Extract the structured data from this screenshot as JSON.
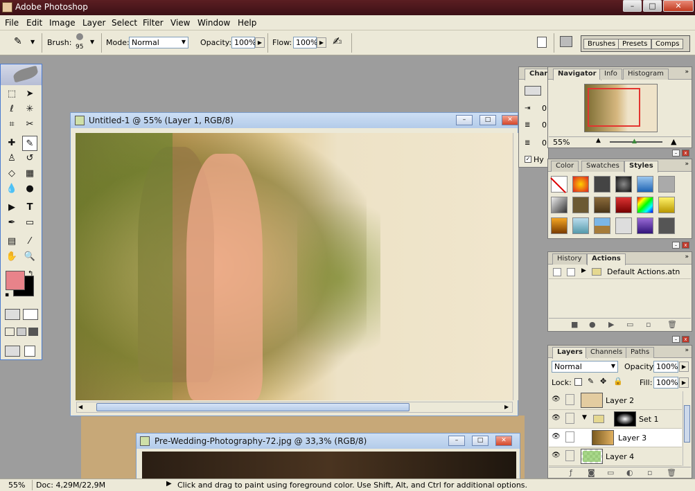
{
  "app": {
    "title": "Adobe Photoshop"
  },
  "menu": [
    "File",
    "Edit",
    "Image",
    "Layer",
    "Select",
    "Filter",
    "View",
    "Window",
    "Help"
  ],
  "options": {
    "brush_label": "Brush:",
    "brush_size": "95",
    "mode_label": "Mode:",
    "mode_value": "Normal",
    "opacity_label": "Opacity:",
    "opacity_value": "100%",
    "flow_label": "Flow:",
    "flow_value": "100%",
    "well_tabs": [
      "Brushes",
      "Presets",
      "Comps"
    ]
  },
  "doc1": {
    "title": "Untitled-1 @ 55% (Layer 1, RGB/8)"
  },
  "doc2": {
    "title": "Pre-Wedding-Photography-72.jpg @ 33,3% (RGB/8)"
  },
  "char_panel": {
    "tab": "Chara",
    "v1": "0",
    "v2": "0",
    "v3": "0",
    "hy": "Hy"
  },
  "navigator": {
    "tabs": [
      "Navigator",
      "Info",
      "Histogram"
    ],
    "zoom": "55%"
  },
  "color_panel": {
    "tabs": [
      "Color",
      "Swatches",
      "Styles"
    ]
  },
  "history_panel": {
    "tabs": [
      "History",
      "Actions"
    ],
    "action_set": "Default Actions.atn"
  },
  "layers_panel": {
    "tabs": [
      "Layers",
      "Channels",
      "Paths"
    ],
    "blend_mode": "Normal",
    "opacity_label": "Opacity:",
    "opacity_value": "100%",
    "lock_label": "Lock:",
    "fill_label": "Fill:",
    "fill_value": "100%",
    "layers": [
      {
        "name": "Layer 2"
      },
      {
        "name": "Set 1"
      },
      {
        "name": "Layer 3"
      },
      {
        "name": "Layer 4"
      }
    ]
  },
  "status": {
    "zoom": "55%",
    "doc": "Doc: 4,29M/22,9M",
    "hint": "Click and drag to paint using foreground color.  Use Shift, Alt, and Ctrl for additional options."
  },
  "colors": {
    "foreground": "#e8838a",
    "background": "#000000",
    "titlebar": "#4a161c"
  }
}
